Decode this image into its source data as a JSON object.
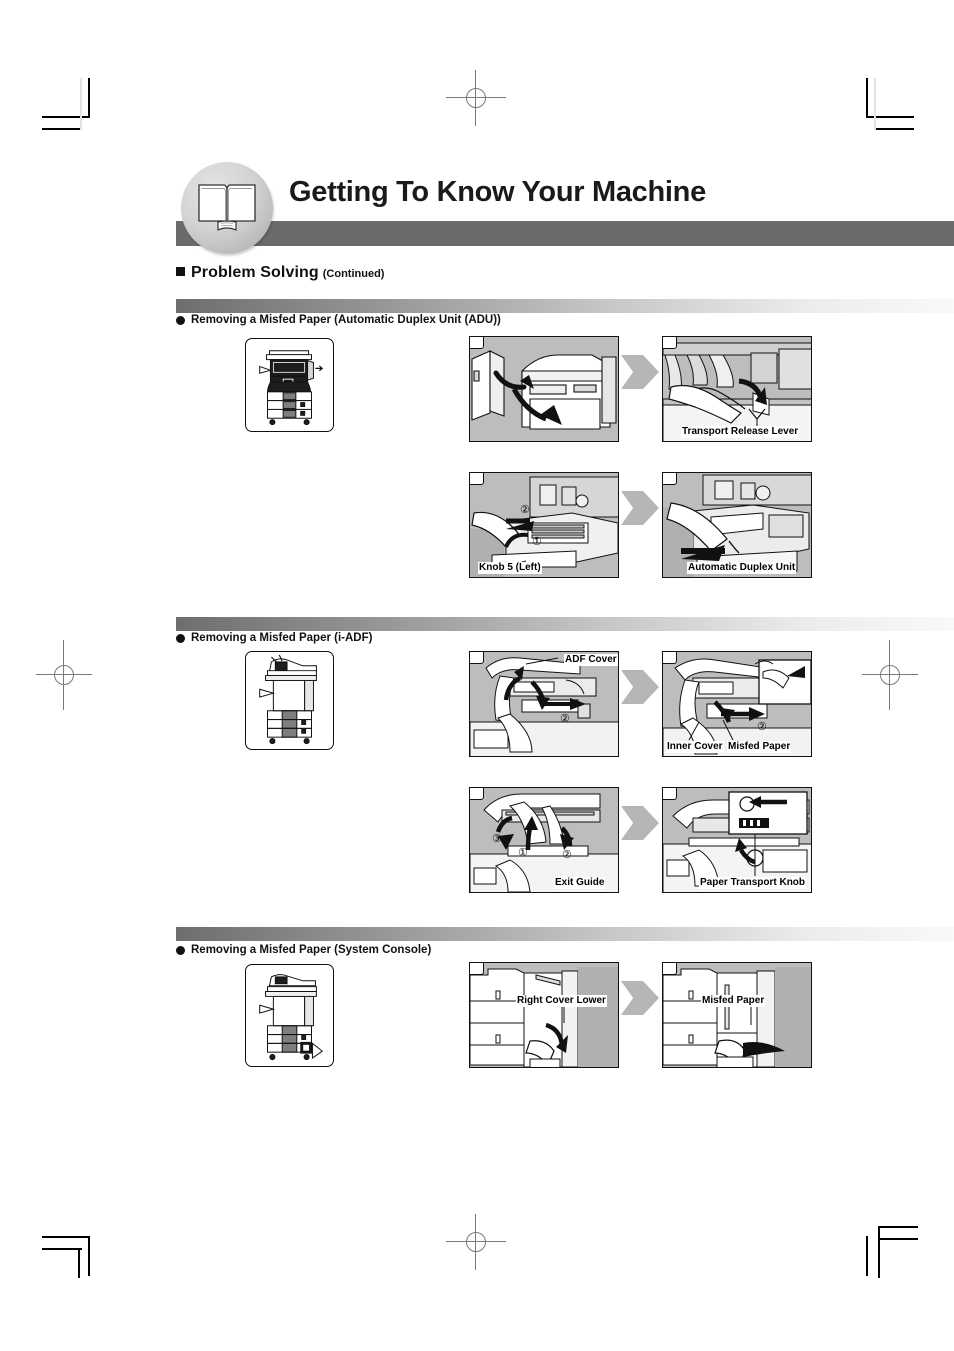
{
  "header": {
    "title": "Getting To Know Your Machine",
    "icon": "open-book-icon"
  },
  "section": {
    "title": "Problem Solving",
    "continued": "(Continued)"
  },
  "subsections": [
    {
      "id": "adu",
      "title": "Removing a Misfed Paper (Automatic Duplex Unit (ADU))",
      "thumbnail_alt": "machine-diagram-adu",
      "panels": [
        {
          "id": "adu-step-1",
          "badge": "",
          "captions": [],
          "steps": []
        },
        {
          "id": "adu-step-2",
          "badge": "",
          "captions": [
            "Transport Release Lever"
          ],
          "steps": []
        },
        {
          "id": "adu-step-3",
          "badge": "",
          "captions": [
            "Knob 5 (Left)"
          ],
          "steps": [
            "1",
            "2"
          ]
        },
        {
          "id": "adu-step-4",
          "badge": "",
          "captions": [
            "Automatic Duplex Unit"
          ],
          "steps": []
        }
      ]
    },
    {
      "id": "iadf",
      "title": "Removing a Misfed Paper (i-ADF)",
      "thumbnail_alt": "machine-diagram-iadf",
      "panels": [
        {
          "id": "iadf-step-1",
          "badge": "",
          "captions": [
            "ADF Cover"
          ],
          "steps": [
            "2"
          ]
        },
        {
          "id": "iadf-step-2",
          "badge": "",
          "captions": [
            "Inner Cover",
            "Misfed Paper"
          ],
          "steps": [
            "2"
          ]
        },
        {
          "id": "iadf-step-3",
          "badge": "",
          "captions": [
            "Exit Guide"
          ],
          "steps": [
            "3",
            "1",
            "2"
          ]
        },
        {
          "id": "iadf-step-4",
          "badge": "",
          "captions": [
            "Paper Transport Knob"
          ],
          "steps": []
        }
      ]
    },
    {
      "id": "syscon",
      "title": "Removing a Misfed Paper (System Console)",
      "thumbnail_alt": "machine-diagram-system-console",
      "panels": [
        {
          "id": "syscon-step-1",
          "badge": "",
          "captions": [
            "Right Cover Lower"
          ],
          "steps": []
        },
        {
          "id": "syscon-step-2",
          "badge": "",
          "captions": [
            "Misfed Paper"
          ],
          "steps": []
        }
      ]
    }
  ],
  "colors": {
    "banner_bar": "#6b6b6b",
    "panel_bg": "#bdbdbd",
    "arrow": "#b6b6b6",
    "text": "#111111"
  }
}
